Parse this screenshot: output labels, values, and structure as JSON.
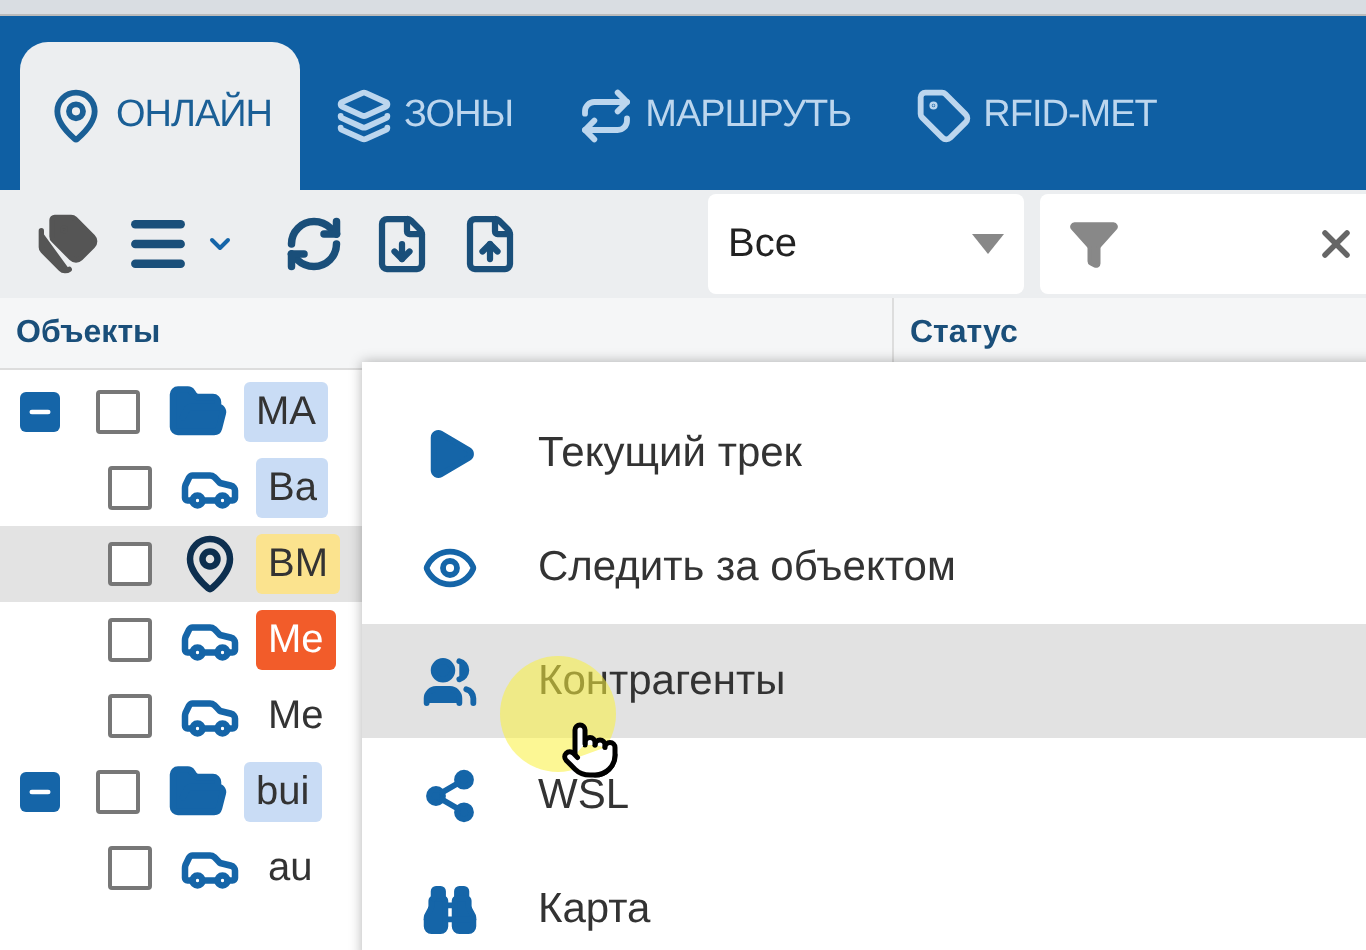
{
  "tabs": [
    {
      "label": "ОНЛАЙН",
      "kind": "pin",
      "selected": true
    },
    {
      "label": "ЗОНЫ",
      "kind": "layers",
      "selected": false
    },
    {
      "label": "МАРШРУТЬ",
      "kind": "route",
      "selected": false
    },
    {
      "label": "RFID-МЕТ",
      "kind": "tag",
      "selected": false
    }
  ],
  "filter": {
    "value": "Все"
  },
  "columns": [
    "Объекты",
    "Статус"
  ],
  "tree": [
    {
      "label": "MA",
      "kind": "folder",
      "expanded": true,
      "checked": false,
      "selected": false,
      "color": "#c9dcf5",
      "children": [
        {
          "label": "Ba",
          "kind": "car",
          "checked": false,
          "selected": false,
          "color": "#c9dcf5"
        },
        {
          "label": "BM",
          "kind": "pin",
          "checked": false,
          "selected": true,
          "color": "#fbe38e"
        },
        {
          "label": "Me",
          "kind": "car",
          "checked": false,
          "selected": false,
          "color": "#f25c2a"
        },
        {
          "label": "Me",
          "kind": "car",
          "checked": false,
          "selected": false
        }
      ]
    },
    {
      "label": "bui",
      "kind": "folder",
      "expanded": true,
      "checked": false,
      "selected": false,
      "color": "#c9dcf5",
      "children": [
        {
          "label": "au",
          "kind": "car",
          "checked": false,
          "selected": false
        }
      ]
    }
  ],
  "context_menu": [
    {
      "label": "Текущий трек",
      "kind": "play",
      "selected": false
    },
    {
      "label": "Следить за объектом",
      "kind": "eye",
      "selected": false
    },
    {
      "label": "Контрагенты",
      "kind": "users",
      "selected": true
    },
    {
      "label": "WSL",
      "kind": "share",
      "selected": false
    },
    {
      "label": "Карта",
      "kind": "binoculars",
      "selected": false
    }
  ]
}
